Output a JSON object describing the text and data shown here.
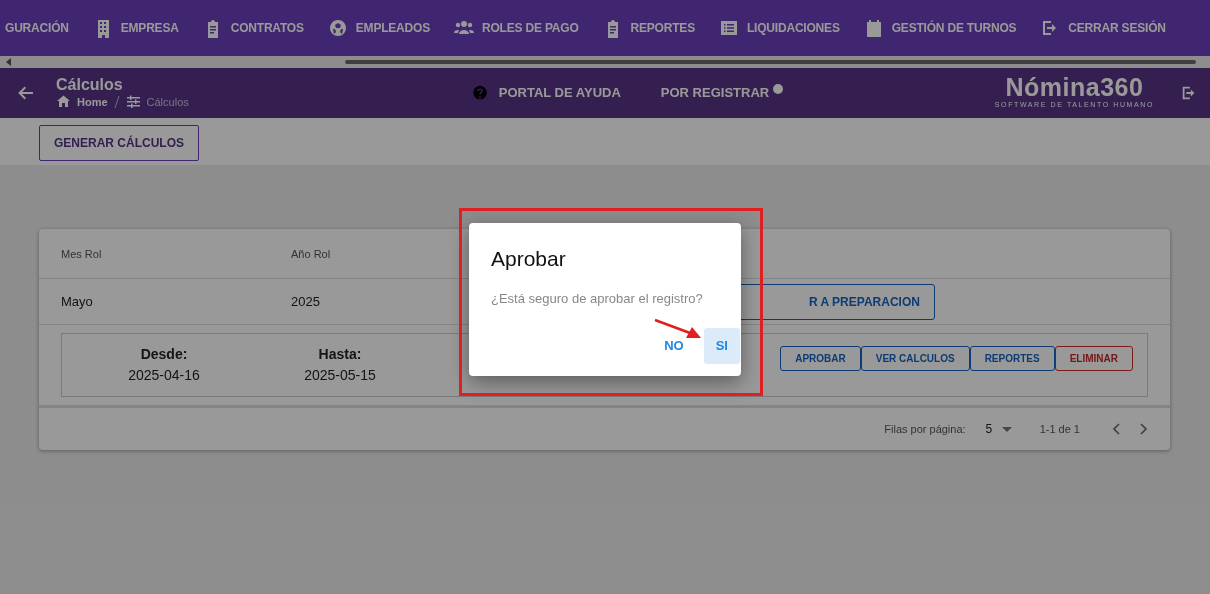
{
  "top_menu": [
    {
      "label": "GURACIÓN"
    },
    {
      "label": "EMPRESA",
      "kind": "building"
    },
    {
      "label": "CONTRATOS",
      "kind": "clipboard"
    },
    {
      "label": "EMPLEADOS",
      "kind": "ball"
    },
    {
      "label": "ROLES DE PAGO",
      "kind": "people"
    },
    {
      "label": "REPORTES",
      "kind": "clipboard"
    },
    {
      "label": "LIQUIDACIONES",
      "kind": "list"
    },
    {
      "label": "GESTIÓN DE TURNOS",
      "kind": "calendar"
    },
    {
      "label": "CERRAR SESIÓN",
      "kind": "logout"
    }
  ],
  "header": {
    "title": "Cálculos",
    "breadcrumb": [
      {
        "label": "Home",
        "kind": "home",
        "current": false
      },
      {
        "label": "Cálculos",
        "kind": "sliders",
        "current": true
      }
    ],
    "links": [
      {
        "label": "PORTAL DE AYUDA",
        "kind": "help"
      },
      {
        "label": "POR REGISTRAR",
        "kind": "dot"
      }
    ],
    "logo": {
      "name": "Nómina360",
      "tagline": "SOFTWARE DE TALENTO HUMANO"
    }
  },
  "toolbar": {
    "button": "GENERAR CÁLCULOS"
  },
  "table": {
    "columns": [
      "Mes Rol",
      "Año Rol"
    ],
    "rows": [
      {
        "cells": [
          "Mayo",
          "2025"
        ],
        "action": "R A PREPARACION",
        "detail": {
          "from_label": "Desde:",
          "from": "2025-04-16",
          "to_label": "Hasta:",
          "to": "2025-05-15",
          "buttons": [
            {
              "label": "APROBAR",
              "kind": "primary"
            },
            {
              "label": "VER CALCULOS",
              "kind": "primary"
            },
            {
              "label": "REPORTES",
              "kind": "primary"
            },
            {
              "label": "ELIMINAR",
              "kind": "danger"
            }
          ]
        }
      }
    ],
    "pagination": {
      "rows_label": "Filas por página:",
      "rows_value": "5",
      "range": "1-1 de 1"
    }
  },
  "dialog": {
    "title": "Aprobar",
    "message": "¿Está seguro de aprobar el registro?",
    "buttons": [
      {
        "label": "NO",
        "selected": false
      },
      {
        "label": "SI",
        "selected": true
      }
    ]
  }
}
